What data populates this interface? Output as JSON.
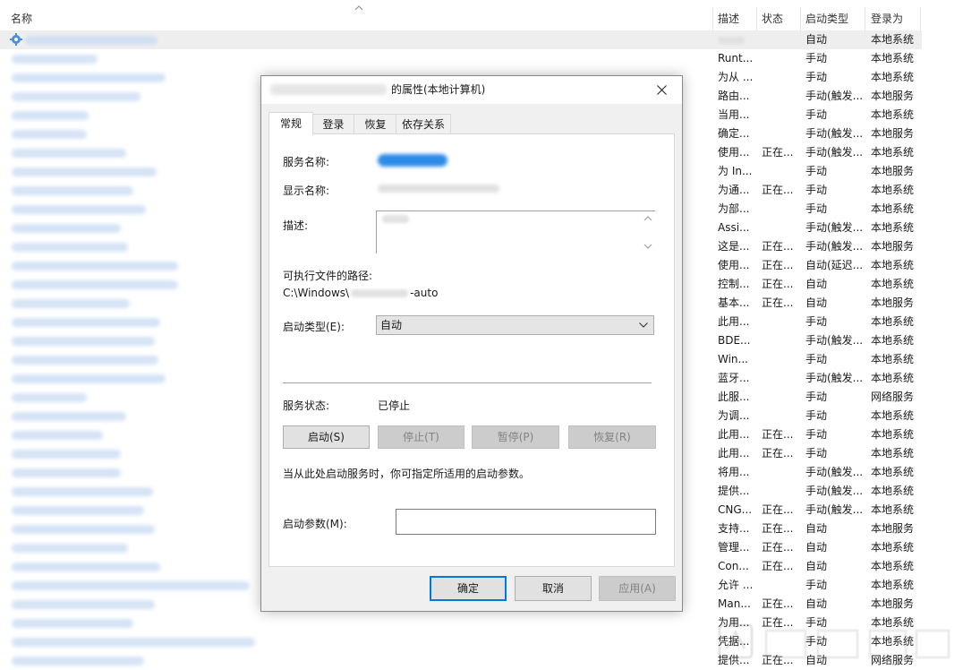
{
  "list": {
    "headers": {
      "name": "名称",
      "desc": "描述",
      "state": "状态",
      "startup": "启动类型",
      "logon": "登录为"
    },
    "rows": [
      {
        "desc": "",
        "state": "",
        "startup": "自动",
        "logon": "本地系统"
      },
      {
        "desc": "Runt...",
        "state": "",
        "startup": "手动",
        "logon": "本地系统"
      },
      {
        "desc": "为从 ...",
        "state": "",
        "startup": "手动",
        "logon": "本地系统"
      },
      {
        "desc": "路由...",
        "state": "",
        "startup": "手动(触发...",
        "logon": "本地服务"
      },
      {
        "desc": "当用...",
        "state": "",
        "startup": "手动",
        "logon": "本地系统"
      },
      {
        "desc": "确定...",
        "state": "",
        "startup": "手动(触发...",
        "logon": "本地服务"
      },
      {
        "desc": "使用...",
        "state": "正在...",
        "startup": "手动(触发...",
        "logon": "本地系统"
      },
      {
        "desc": "为 In...",
        "state": "",
        "startup": "手动",
        "logon": "本地服务"
      },
      {
        "desc": "为通...",
        "state": "正在...",
        "startup": "手动",
        "logon": "本地系统"
      },
      {
        "desc": "为部...",
        "state": "",
        "startup": "手动",
        "logon": "本地系统"
      },
      {
        "desc": "Assi...",
        "state": "",
        "startup": "手动(触发...",
        "logon": "本地系统"
      },
      {
        "desc": "这是...",
        "state": "正在...",
        "startup": "手动(触发...",
        "logon": "本地服务"
      },
      {
        "desc": "使用...",
        "state": "正在...",
        "startup": "自动(延迟...",
        "logon": "本地系统"
      },
      {
        "desc": "控制...",
        "state": "正在...",
        "startup": "自动",
        "logon": "本地系统"
      },
      {
        "desc": "基本...",
        "state": "正在...",
        "startup": "自动",
        "logon": "本地服务"
      },
      {
        "desc": "此用...",
        "state": "",
        "startup": "手动",
        "logon": "本地系统"
      },
      {
        "desc": "BDE...",
        "state": "",
        "startup": "手动(触发...",
        "logon": "本地系统"
      },
      {
        "desc": "Win...",
        "state": "",
        "startup": "手动",
        "logon": "本地系统"
      },
      {
        "desc": "蓝牙...",
        "state": "",
        "startup": "手动(触发...",
        "logon": "本地系统"
      },
      {
        "desc": "此服...",
        "state": "",
        "startup": "手动",
        "logon": "网络服务"
      },
      {
        "desc": "为调...",
        "state": "",
        "startup": "手动",
        "logon": "本地系统"
      },
      {
        "desc": "此用...",
        "state": "正在...",
        "startup": "手动",
        "logon": "本地系统"
      },
      {
        "desc": "此用...",
        "state": "正在...",
        "startup": "手动",
        "logon": "本地系统"
      },
      {
        "desc": "将用...",
        "state": "",
        "startup": "手动(触发...",
        "logon": "本地系统"
      },
      {
        "desc": "提供...",
        "state": "",
        "startup": "手动(触发...",
        "logon": "本地系统"
      },
      {
        "desc": "CNG...",
        "state": "正在...",
        "startup": "手动(触发...",
        "logon": "本地系统"
      },
      {
        "desc": "支持...",
        "state": "正在...",
        "startup": "自动",
        "logon": "本地服务"
      },
      {
        "desc": "管理...",
        "state": "正在...",
        "startup": "自动",
        "logon": "本地系统"
      },
      {
        "desc": "Con...",
        "state": "正在...",
        "startup": "自动",
        "logon": "本地系统"
      },
      {
        "desc": "允许 ...",
        "state": "",
        "startup": "手动",
        "logon": "本地系统"
      },
      {
        "desc": "Man...",
        "state": "正在...",
        "startup": "自动",
        "logon": "本地服务"
      },
      {
        "desc": "为用...",
        "state": "正在...",
        "startup": "手动",
        "logon": "本地系统"
      },
      {
        "desc": "凭据...",
        "state": "",
        "startup": "手动",
        "logon": "本地系统"
      },
      {
        "desc": "提供...",
        "state": "正在...",
        "startup": "自动",
        "logon": "网络服务"
      }
    ]
  },
  "dialog": {
    "title_suffix": "的属性(本地计算机)",
    "tabs": [
      "常规",
      "登录",
      "恢复",
      "依存关系"
    ],
    "service_name_label": "服务名称:",
    "display_name_label": "显示名称:",
    "description_label": "描述:",
    "exe_path_label": "可执行文件的路径:",
    "exe_path_prefix": "C:\\Windows\\",
    "exe_path_suffix": "-auto",
    "startup_type_label": "启动类型(E):",
    "startup_type_value": "自动",
    "service_status_label": "服务状态:",
    "service_status_value": "已停止",
    "buttons": {
      "start": "启动(S)",
      "stop": "停止(T)",
      "pause": "暂停(P)",
      "resume": "恢复(R)"
    },
    "hint_text": "当从此处启动服务时，你可指定所适用的启动参数。",
    "start_params_label": "启动参数(M):",
    "start_params_value": "",
    "footer": {
      "ok": "确定",
      "cancel": "取消",
      "apply": "应用(A)"
    }
  },
  "colors": {
    "accent": "#0078d7",
    "selected_row": "#eeeeee",
    "dialog_bg": "#f0f0f0"
  }
}
